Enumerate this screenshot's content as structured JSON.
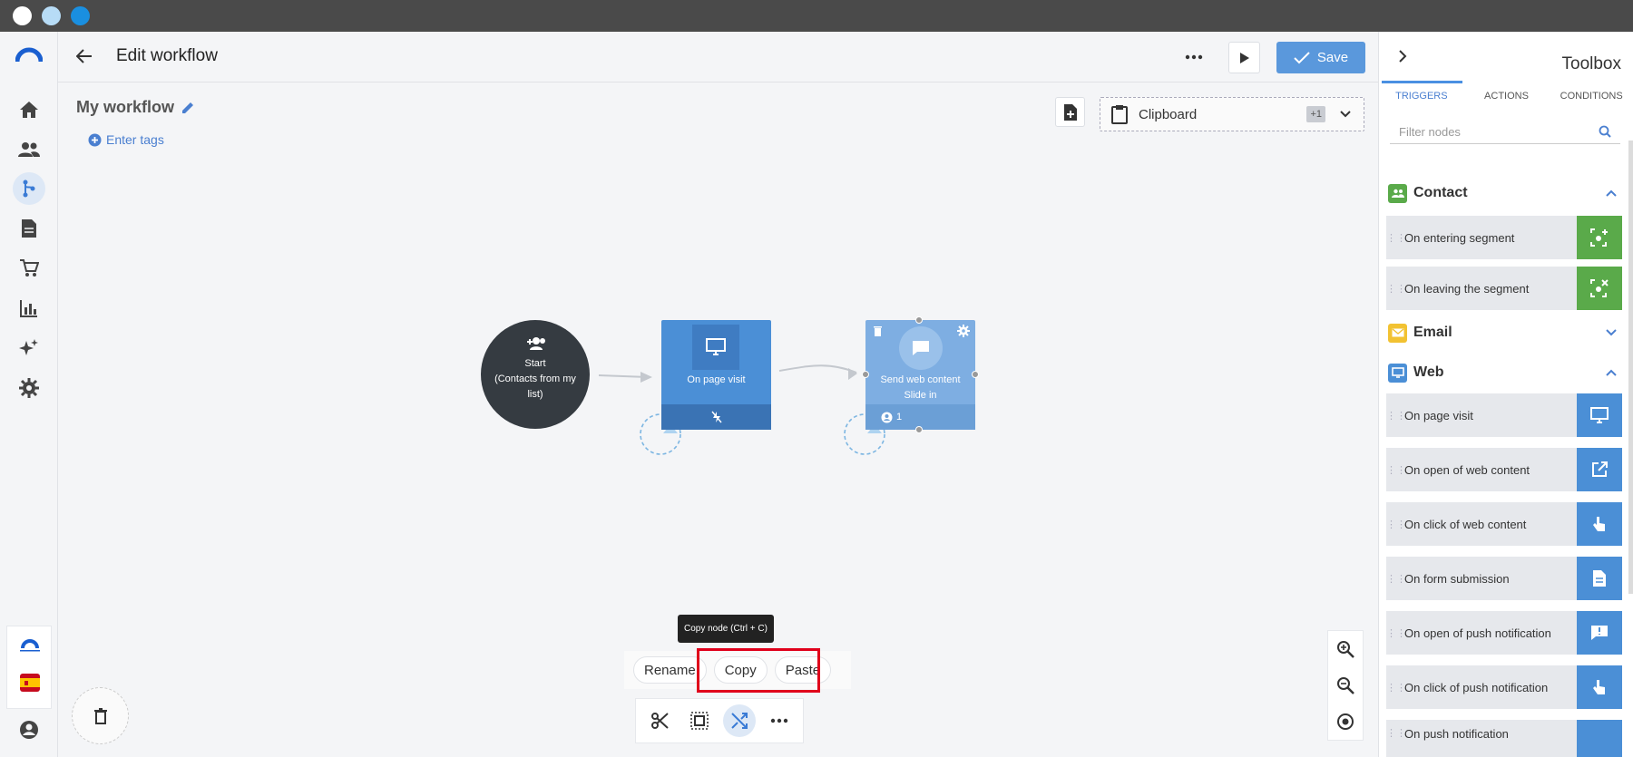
{
  "window": {
    "colors": {
      "dot1": "#ffffff",
      "dot2": "#b7dcf6",
      "dot3": "#1a8fe0"
    }
  },
  "header": {
    "title": "Edit workflow",
    "save_label": "Save"
  },
  "workflow": {
    "name": "My workflow",
    "tags_label": "Enter tags"
  },
  "clipboard": {
    "label": "Clipboard",
    "badge": "+1"
  },
  "nodes": {
    "start": {
      "line1": "Start",
      "line2": "(Contacts from my list)"
    },
    "page_visit": {
      "label": "On page visit"
    },
    "web_content": {
      "label_1": "Send web content",
      "label_2": "Slide in",
      "count": "1"
    }
  },
  "context_menu": {
    "rename": "Rename",
    "copy": "Copy",
    "paste": "Paste",
    "tooltip": "Copy node (Ctrl + C)"
  },
  "toolbox": {
    "title": "Toolbox",
    "tabs": [
      "TRIGGERS",
      "ACTIONS",
      "CONDITIONS"
    ],
    "filter_placeholder": "Filter nodes",
    "categories": {
      "contact": "Contact",
      "email": "Email",
      "web": "Web"
    },
    "contact_items": [
      "On entering segment",
      "On leaving the segment"
    ],
    "web_items": [
      "On page visit",
      "On open of web content",
      "On click of web content",
      "On form submission",
      "On open of push notification",
      "On click of push notification",
      "On push notification"
    ]
  },
  "colors": {
    "accent": "#4a90e2",
    "save": "#5a98dc",
    "green": "#5aaa4a",
    "email": "#f2c232",
    "node_blue": "#4b8fd6",
    "node_light": "#7eaee2",
    "highlight": "#e0001b"
  }
}
